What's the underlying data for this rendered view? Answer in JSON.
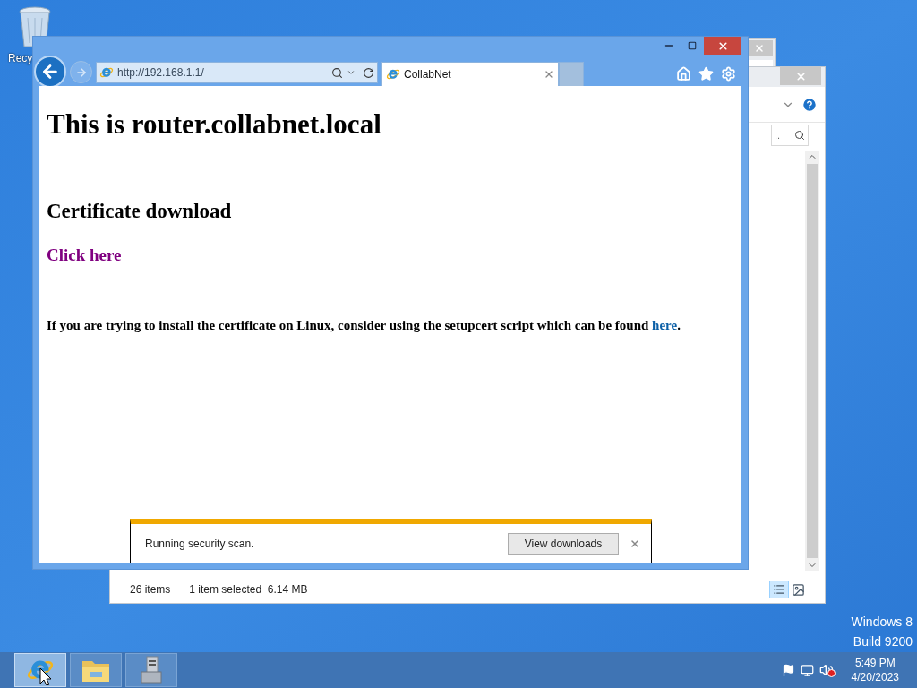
{
  "desktop": {
    "icons": [
      {
        "label": "Recy"
      }
    ],
    "os_info": [
      "Windows 8",
      "Build 9200"
    ]
  },
  "explorer_window": {
    "status": [
      "26 items",
      "1 item selected  6.14 MB"
    ],
    "search_placeholder": ".."
  },
  "browser": {
    "address": "http://192.168.1.1/",
    "tabs": [
      {
        "title": "CollabNet",
        "selected": true
      }
    ],
    "page": {
      "heading": "This is router.collabnet.local",
      "subheading": "Certificate download",
      "link": "Click here",
      "paragraph": "If you are trying to install the certificate on Linux, consider using the setupcert script which can be found ",
      "paragraph_link": "here",
      "paragraph_end": "."
    },
    "download_bar": {
      "message": "Running security scan.",
      "button": "View downloads"
    }
  },
  "taskbar": {
    "apps": [
      {
        "kind": "browser",
        "selected": true
      },
      {
        "kind": "folder",
        "selected": false
      },
      {
        "kind": "server",
        "selected": false
      }
    ],
    "clock": {
      "time": "5:49 PM",
      "date": "4/20/2023"
    }
  }
}
